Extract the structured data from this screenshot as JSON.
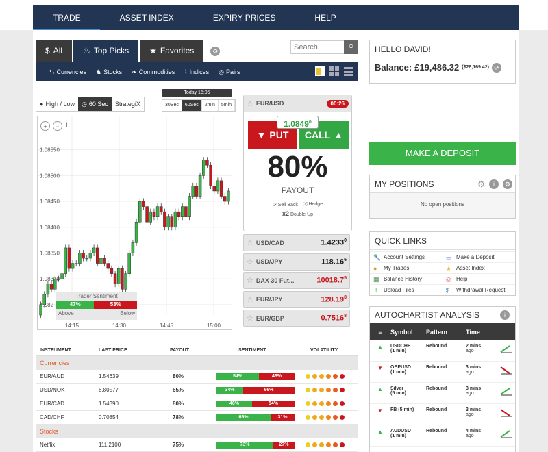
{
  "nav": [
    "TRADE",
    "ASSET INDEX",
    "EXPIRY PRICES",
    "HELP"
  ],
  "tabs": [
    {
      "label": "All",
      "icon": "dollar-icon"
    },
    {
      "label": "Top Picks",
      "icon": "flame-icon"
    },
    {
      "label": "Favorites",
      "icon": "star-icon"
    }
  ],
  "search": {
    "placeholder": "Search"
  },
  "categories": [
    "Currencies",
    "Stocks",
    "Commodities",
    "Indices",
    "Pairs"
  ],
  "modes": [
    "High / Low",
    "60 Sec",
    "StrategiX"
  ],
  "today_label": "Today 15:05",
  "durations": [
    "30Sec",
    "60Sec",
    "2min",
    "5min"
  ],
  "chart_data": {
    "type": "candlestick",
    "y_ticks": [
      "1.08550",
      "1.08500",
      "1.08450",
      "1.08400",
      "1.08350",
      "1.08300",
      "1.082"
    ],
    "x_ticks": [
      "14:15",
      "14:30",
      "14:45",
      "15:00"
    ],
    "ylim": [
      1.0823,
      1.0858
    ],
    "closes": [
      1.0825,
      1.0827,
      1.0829,
      1.0828,
      1.083,
      1.083,
      1.0831,
      1.0836,
      1.0832,
      1.0833,
      1.0833,
      1.0835,
      1.0834,
      1.0834,
      1.0835,
      1.0836,
      1.0833,
      1.0834,
      1.0833,
      1.0832,
      1.0831,
      1.0829,
      1.0832,
      1.0828,
      1.0831,
      1.0835,
      1.0837,
      1.0841,
      1.0845,
      1.0844,
      1.0841,
      1.0843,
      1.0842,
      1.0844,
      1.0843,
      1.084,
      1.0842,
      1.084,
      1.0843,
      1.0842,
      1.0844,
      1.0842,
      1.0846,
      1.0848,
      1.0846,
      1.085,
      1.0853,
      1.0852,
      1.0848,
      1.0847,
      1.0849,
      1.0846,
      1.0845,
      1.0847
    ]
  },
  "sentiment": {
    "title": "Trader Sentiment",
    "above": "47%",
    "below": "53%",
    "above_label": "Above",
    "below_label": "Below",
    "above_frac": 0.47
  },
  "main_asset": {
    "name": "EUR/USD",
    "timer": "00:26",
    "quote": "1.0849",
    "quote_sup": "0",
    "put": "PUT",
    "call": "CALL",
    "payout_pct": "80%",
    "payout_label": "PAYOUT",
    "sell_back": "Sell Back",
    "hedge": "Hedge",
    "double_up": "Double Up",
    "x2": "x2"
  },
  "assets": [
    {
      "name": "USD/CAD",
      "price": "1.4233",
      "sup": "0",
      "color": "#222"
    },
    {
      "name": "USD/JPY",
      "price": "118.16",
      "sup": "6",
      "color": "#222"
    },
    {
      "name": "DAX 30 Fut...",
      "price": "10018.7",
      "sup": "5",
      "color": "#c8181e"
    },
    {
      "name": "EUR/JPY",
      "price": "128.19",
      "sup": "8",
      "color": "#c8181e"
    },
    {
      "name": "EUR/GBP",
      "price": "0.7516",
      "sup": "8",
      "color": "#c8181e"
    }
  ],
  "user": {
    "greeting": "HELLO DAVID!",
    "balance_label": "Balance:",
    "balance": "£19,486.32",
    "balance_sub": "($28,169.42)"
  },
  "deposit_button": "MAKE A DEPOSIT",
  "positions": {
    "title": "MY POSITIONS",
    "empty": "No open positions"
  },
  "quick_links": {
    "title": "QUICK LINKS",
    "items": [
      {
        "label": "Account Settings",
        "icon": "wrench-icon"
      },
      {
        "label": "Make a Deposit",
        "icon": "card-icon"
      },
      {
        "label": "My Trades",
        "icon": "coins-icon"
      },
      {
        "label": "Asset Index",
        "icon": "star-icon"
      },
      {
        "label": "Balance History",
        "icon": "calendar-icon"
      },
      {
        "label": "Help",
        "icon": "lifebuoy-icon"
      },
      {
        "label": "Upload Files",
        "icon": "upload-icon"
      },
      {
        "label": "Withdrawal Request",
        "icon": "money-icon"
      }
    ]
  },
  "autochartist": {
    "title": "AUTOCHARTIST ANALYSIS",
    "headers": [
      "Symbol",
      "Pattern",
      "Time"
    ],
    "rows": [
      {
        "dir": "up",
        "symbol": "USDCHF",
        "sub": "(1 min)",
        "pattern": "Rebound",
        "time": "2 mins",
        "time2": "ago"
      },
      {
        "dir": "down",
        "symbol": "GBPUSD",
        "sub": "(1 min)",
        "pattern": "Rebound",
        "time": "3 mins",
        "time2": "ago"
      },
      {
        "dir": "up",
        "symbol": "Silver",
        "sub": "(5 min)",
        "pattern": "Rebound",
        "time": "3 mins",
        "time2": "ago"
      },
      {
        "dir": "down",
        "symbol": "FB (5 min)",
        "sub": "",
        "pattern": "Rebound",
        "time": "3 mins",
        "time2": "ago"
      },
      {
        "dir": "up",
        "symbol": "AUDUSD",
        "sub": "(1 min)",
        "pattern": "Rebound",
        "time": "4 mins",
        "time2": "ago"
      }
    ]
  },
  "table": {
    "headers": [
      "INSTRUMENT",
      "LAST PRICE",
      "PAYOUT",
      "SENTIMENT",
      "VOLATILITY"
    ],
    "groups": [
      {
        "name": "Currencies",
        "rows": [
          {
            "instrument": "EUR/AUD",
            "price": "1.54639",
            "payout": "80%",
            "up": "54%",
            "down": "46%",
            "up_frac": 0.54
          },
          {
            "instrument": "USD/NOK",
            "price": "8.80577",
            "payout": "65%",
            "up": "34%",
            "down": "66%",
            "up_frac": 0.34
          },
          {
            "instrument": "EUR/CAD",
            "price": "1.54390",
            "payout": "80%",
            "up": "46%",
            "down": "54%",
            "up_frac": 0.46
          },
          {
            "instrument": "CAD/CHF",
            "price": "0.70854",
            "payout": "78%",
            "up": "69%",
            "down": "31%",
            "up_frac": 0.69
          }
        ]
      },
      {
        "name": "Stocks",
        "rows": [
          {
            "instrument": "Netflix",
            "price": "111.2100",
            "payout": "75%",
            "up": "73%",
            "down": "27%",
            "up_frac": 0.73
          }
        ]
      }
    ]
  },
  "colors": {
    "navy": "#223553",
    "green": "#3ab449",
    "red": "#c8181e",
    "orange": "#e05a2b"
  }
}
